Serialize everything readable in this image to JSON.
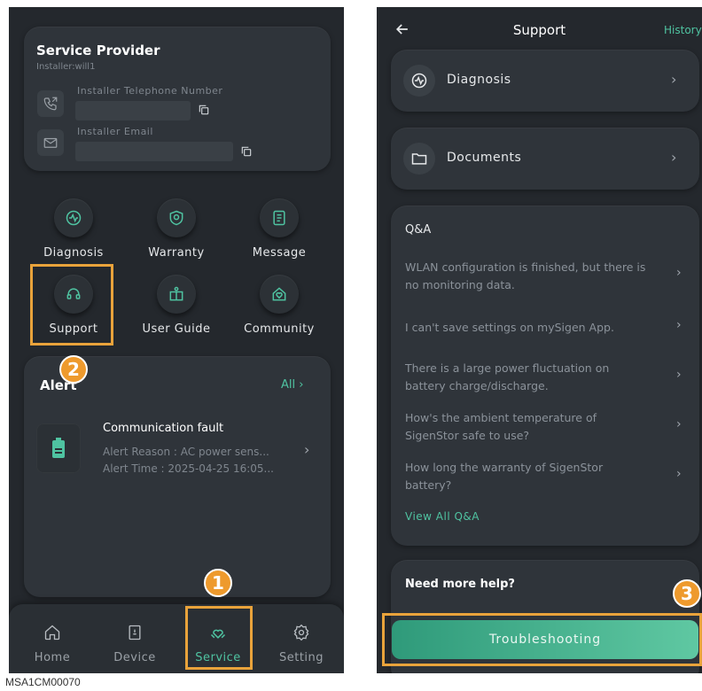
{
  "left": {
    "provider": {
      "title": "Service Provider",
      "installer": "Installer:will1",
      "phone_label": "Installer Telephone Number",
      "email_label": "Installer Email"
    },
    "grid": [
      {
        "label": "Diagnosis",
        "icon": "diagnosis-icon"
      },
      {
        "label": "Warranty",
        "icon": "warranty-icon"
      },
      {
        "label": "Message",
        "icon": "message-icon"
      },
      {
        "label": "Support",
        "icon": "headset-icon"
      },
      {
        "label": "User Guide",
        "icon": "user-guide-icon"
      },
      {
        "label": "Community",
        "icon": "community-icon"
      }
    ],
    "alert": {
      "title": "Alert",
      "all_label": "All",
      "fault_title": "Communication fault",
      "reason": "Alert Reason : AC power sens...",
      "time": "Alert Time : 2025-04-25 16:05..."
    },
    "tabs": [
      {
        "label": "Home",
        "icon": "home-icon"
      },
      {
        "label": "Device",
        "icon": "device-icon"
      },
      {
        "label": "Service",
        "icon": "service-icon"
      },
      {
        "label": "Setting",
        "icon": "setting-icon"
      }
    ]
  },
  "right": {
    "header": {
      "title": "Support",
      "history": "History"
    },
    "menu": [
      {
        "label": "Diagnosis",
        "icon": "diagnosis-icon"
      },
      {
        "label": "Documents",
        "icon": "folder-icon"
      }
    ],
    "qa": {
      "title": "Q&A",
      "items": [
        "WLAN configuration is finished, but there is no monitoring data.",
        "I can't save settings on mySigen App.",
        "There is a large power fluctuation on battery charge/discharge.",
        "How's the ambient temperature of SigenStor safe to use?",
        "How long the warranty of SigenStor battery?"
      ],
      "view_all": "View All Q&A"
    },
    "help": {
      "title": "Need more help?",
      "button": "Troubleshooting"
    }
  },
  "steps": [
    "1",
    "2",
    "3"
  ],
  "caption": "MSA1CM00070",
  "colors": {
    "accent": "#4fc3a1",
    "highlight": "#e9a33b",
    "background": "#24282d"
  }
}
